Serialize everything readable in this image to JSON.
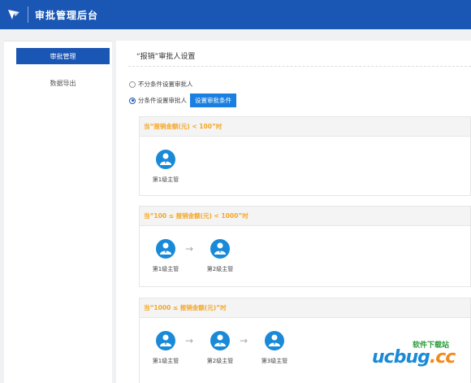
{
  "header": {
    "title": "审批管理后台"
  },
  "sidebar": {
    "items": [
      {
        "label": "审批管理"
      },
      {
        "label": "数据导出"
      }
    ]
  },
  "main": {
    "title": "“报销”审批人设置",
    "options": [
      {
        "label": "不分条件设置审批人",
        "checked": false
      },
      {
        "label": "分条件设置审批人",
        "checked": true
      }
    ],
    "condition_button": "设置审批条件",
    "blocks": [
      {
        "condition": "当“报销金额(元) < 100”时",
        "nodes": [
          "第1级主管"
        ]
      },
      {
        "condition": "当“100 ≤ 报销金额(元) < 1000”时",
        "nodes": [
          "第1级主管",
          "第2级主管"
        ]
      },
      {
        "condition": "当“1000 ≤ 报销金额(元)”时",
        "nodes": [
          "第1级主管",
          "第2级主管",
          "第3级主管"
        ]
      }
    ],
    "arrow": "→"
  },
  "watermark": {
    "small": "软件下载站",
    "big_a": "ucbug",
    "big_b": ".cc"
  },
  "colors": {
    "primary": "#1a56b4",
    "accent": "#f5a623",
    "icon": "#1a8ad8"
  }
}
